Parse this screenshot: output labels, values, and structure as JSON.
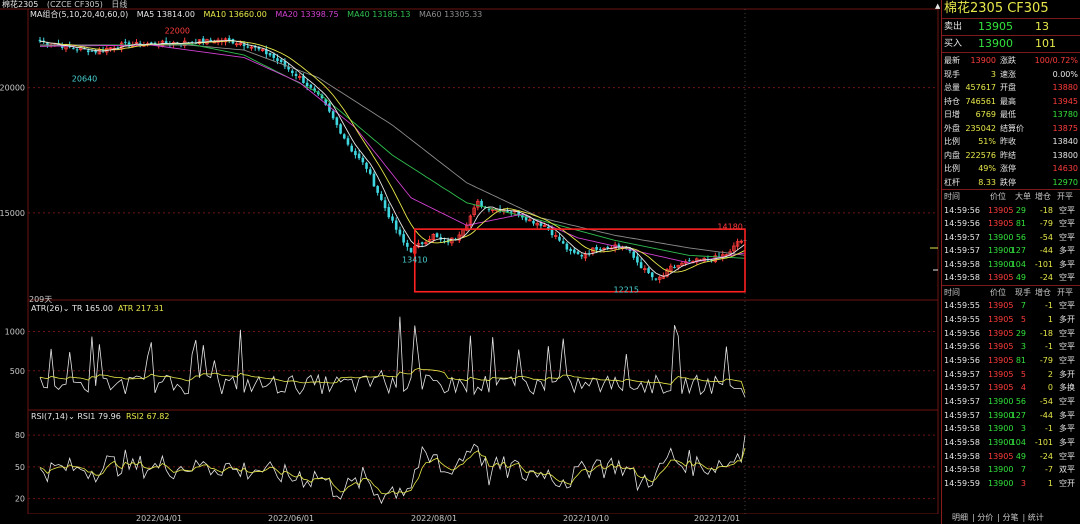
{
  "header": {
    "title": "棉花2305",
    "exchange": "(CZCE CF305)",
    "period": "日线",
    "ma_group": "MA组合(5,10,20,40,60,0)",
    "ma5": "MA5 13814.00",
    "ma10": "MA10 13660.00",
    "ma20": "MA20 13398.75",
    "ma40": "MA40 13185.13",
    "ma60": "MA60 13305.33"
  },
  "colors": {
    "up": "#ff3c3c",
    "down": "#3fd7df",
    "ma5": "#e6e6e6",
    "ma10": "#e8e84a",
    "ma20": "#d040d0",
    "ma40": "#2fbf4f",
    "ma60": "#8c8c8c",
    "grid": "#6e1414",
    "box": "#ff2020"
  },
  "chart_data": [
    {
      "type": "candlestick",
      "title": "棉花2305 日线",
      "y_ticks": [
        "20000",
        "15000"
      ],
      "y_tick_values": [
        20000,
        15000
      ],
      "ylim": [
        11600,
        22700
      ],
      "annotations": [
        {
          "label": "22000",
          "value": 22000
        },
        {
          "label": "20640",
          "value": 20640
        },
        {
          "label": "13410",
          "value": 13410
        },
        {
          "label": "12215",
          "value": 12215
        },
        {
          "label": "14180",
          "value": 14180
        }
      ],
      "price_path": [
        [
          0,
          21850
        ],
        [
          8,
          21600
        ],
        [
          15,
          21450
        ],
        [
          22,
          21700
        ],
        [
          30,
          21750
        ],
        [
          38,
          21800
        ],
        [
          45,
          21850
        ],
        [
          50,
          21900
        ],
        [
          56,
          21700
        ],
        [
          62,
          21300
        ],
        [
          66,
          20850
        ],
        [
          70,
          20400
        ],
        [
          76,
          19500
        ],
        [
          80,
          18500
        ],
        [
          84,
          17500
        ],
        [
          88,
          16800
        ],
        [
          92,
          15500
        ],
        [
          95,
          14600
        ],
        [
          98,
          13800
        ],
        [
          100,
          13500
        ],
        [
          103,
          13800
        ],
        [
          106,
          14100
        ],
        [
          109,
          13800
        ],
        [
          112,
          14000
        ],
        [
          115,
          14600
        ],
        [
          118,
          15400
        ],
        [
          120,
          15200
        ],
        [
          124,
          15150
        ],
        [
          128,
          15050
        ],
        [
          132,
          14700
        ],
        [
          136,
          14500
        ],
        [
          138,
          14200
        ],
        [
          140,
          13900
        ],
        [
          143,
          13400
        ],
        [
          146,
          13300
        ],
        [
          150,
          13600
        ],
        [
          155,
          13700
        ],
        [
          158,
          13600
        ],
        [
          160,
          13200
        ],
        [
          163,
          12700
        ],
        [
          166,
          12300
        ],
        [
          168,
          12500
        ],
        [
          170,
          12800
        ],
        [
          174,
          13000
        ],
        [
          178,
          13100
        ],
        [
          182,
          13200
        ],
        [
          186,
          13400
        ],
        [
          188,
          13850
        ],
        [
          190,
          13905
        ]
      ],
      "ma_values": {
        "ma60": [
          [
            0,
            21700
          ],
          [
            40,
            21700
          ],
          [
            55,
            21500
          ],
          [
            75,
            20400
          ],
          [
            95,
            18500
          ],
          [
            115,
            16200
          ],
          [
            135,
            14800
          ],
          [
            155,
            14100
          ],
          [
            175,
            13600
          ],
          [
            190,
            13305
          ]
        ],
        "ma40": [
          [
            0,
            21650
          ],
          [
            40,
            21750
          ],
          [
            55,
            21300
          ],
          [
            75,
            19800
          ],
          [
            95,
            17300
          ],
          [
            115,
            15400
          ],
          [
            135,
            14700
          ],
          [
            155,
            13900
          ],
          [
            175,
            13300
          ],
          [
            190,
            13185
          ]
        ],
        "ma20": [
          [
            0,
            21650
          ],
          [
            30,
            21700
          ],
          [
            55,
            21200
          ],
          [
            70,
            20200
          ],
          [
            85,
            18400
          ],
          [
            100,
            15600
          ],
          [
            115,
            14500
          ],
          [
            130,
            14950
          ],
          [
            145,
            14000
          ],
          [
            160,
            13500
          ],
          [
            175,
            13000
          ],
          [
            190,
            13399
          ]
        ]
      },
      "highlight_range": {
        "x_start": 101,
        "x_end": 190,
        "y_low": 11850,
        "y_high": 14350
      }
    },
    {
      "type": "line",
      "title": "ATR(26)",
      "series": [
        {
          "name": "TR",
          "value_label": "TR 165.00",
          "color": "#e6e6e6"
        },
        {
          "name": "ATR",
          "value_label": "ATR 217.31",
          "color": "#e8e84a"
        }
      ],
      "y_ticks": [
        "1000",
        "500"
      ],
      "y_tick_values": [
        1000,
        500
      ]
    },
    {
      "type": "line",
      "title": "RSI(7,14)",
      "series": [
        {
          "name": "RSI1",
          "value_label": "RSI1 79.96",
          "color": "#e6e6e6"
        },
        {
          "name": "RSI2",
          "value_label": "RSI2 67.82",
          "color": "#e8e84a"
        }
      ],
      "y_ticks": [
        "80",
        "50",
        "20"
      ],
      "y_tick_values": [
        80,
        50,
        20
      ]
    }
  ],
  "dates": [
    "2022/04/01",
    "2022/06/01",
    "2022/08/01",
    "2022/10/10",
    "2022/12/01"
  ],
  "days_label": "209天",
  "right_panel": {
    "title": "棉花2305  CF305",
    "ask_label": "卖出",
    "ask_price": "13905",
    "ask_vol": "13",
    "bid_label": "买入",
    "bid_price": "13900",
    "bid_vol": "101",
    "stats": [
      {
        "k1": "最新",
        "v1": "13900",
        "c1": "red",
        "k2": "涨跌",
        "v2": "100/0.72%",
        "c2": "red"
      },
      {
        "k1": "现手",
        "v1": "3",
        "c1": "yellow",
        "k2": "速涨",
        "v2": "0.00%",
        "c2": "white"
      },
      {
        "k1": "总量",
        "v1": "457617",
        "c1": "yellow",
        "k2": "开盘",
        "v2": "13880",
        "c2": "red"
      },
      {
        "k1": "持仓",
        "v1": "746561",
        "c1": "yellow",
        "k2": "最高",
        "v2": "13945",
        "c2": "red"
      },
      {
        "k1": "日增",
        "v1": "6769",
        "c1": "yellow",
        "k2": "最低",
        "v2": "13780",
        "c2": "green"
      },
      {
        "k1": "外盘",
        "v1": "235042",
        "c1": "yellow",
        "k2": "结算价",
        "v2": "13875",
        "c2": "red"
      },
      {
        "k1": "比例",
        "v1": "51%",
        "c1": "yellow",
        "k2": "昨收",
        "v2": "13840",
        "c2": "white"
      },
      {
        "k1": "内盘",
        "v1": "222576",
        "c1": "yellow",
        "k2": "昨结",
        "v2": "13800",
        "c2": "white"
      },
      {
        "k1": "比例",
        "v1": "49%",
        "c1": "yellow",
        "k2": "涨停",
        "v2": "14630",
        "c2": "red"
      },
      {
        "k1": "杠杆",
        "v1": "8.33",
        "c1": "yellow",
        "k2": "跌停",
        "v2": "12970",
        "c2": "green"
      }
    ],
    "tick_header1": {
      "time": "时间",
      "price": "价位",
      "vol": "大单",
      "oi": "增仓",
      "type": "开平"
    },
    "ticks1": [
      {
        "time": "14:59:56",
        "price": "13905",
        "vol": "29",
        "oi": "-18",
        "type": "空平"
      },
      {
        "time": "14:59:56",
        "price": "13905",
        "vol": "81",
        "oi": "-79",
        "type": "空平"
      },
      {
        "time": "14:59:57",
        "price": "13900",
        "vol": "56",
        "oi": "-54",
        "type": "空平"
      },
      {
        "time": "14:59:57",
        "price": "13900",
        "vol": "127",
        "oi": "-44",
        "type": "多平"
      },
      {
        "time": "14:59:58",
        "price": "13900",
        "vol": "104",
        "oi": "-101",
        "type": "多平"
      },
      {
        "time": "14:59:58",
        "price": "13905",
        "vol": "49",
        "oi": "-24",
        "type": "空平"
      }
    ],
    "tick_header2": {
      "time": "时间",
      "price": "价位",
      "vol": "现手",
      "oi": "增仓",
      "type": "开平"
    },
    "ticks2": [
      {
        "time": "14:59:55",
        "price": "13905",
        "vol": "7",
        "oi": "-1",
        "type": "空平"
      },
      {
        "time": "14:59:55",
        "price": "13905",
        "vol": "5",
        "oi": "1",
        "type": "多开"
      },
      {
        "time": "14:59:56",
        "price": "13905",
        "vol": "29",
        "oi": "-18",
        "type": "空平"
      },
      {
        "time": "14:59:56",
        "price": "13905",
        "vol": "3",
        "oi": "-1",
        "type": "空平"
      },
      {
        "time": "14:59:56",
        "price": "13905",
        "vol": "81",
        "oi": "-79",
        "type": "空平"
      },
      {
        "time": "14:59:57",
        "price": "13905",
        "vol": "5",
        "oi": "2",
        "type": "多开"
      },
      {
        "time": "14:59:57",
        "price": "13905",
        "vol": "4",
        "oi": "0",
        "type": "多换"
      },
      {
        "time": "14:59:57",
        "price": "13900",
        "vol": "56",
        "oi": "-54",
        "type": "空平"
      },
      {
        "time": "14:59:57",
        "price": "13900",
        "vol": "127",
        "oi": "-44",
        "type": "多平"
      },
      {
        "time": "14:59:58",
        "price": "13900",
        "vol": "3",
        "oi": "-1",
        "type": "多平"
      },
      {
        "time": "14:59:58",
        "price": "13900",
        "vol": "104",
        "oi": "-101",
        "type": "多平"
      },
      {
        "time": "14:59:58",
        "price": "13905",
        "vol": "49",
        "oi": "-24",
        "type": "空平"
      },
      {
        "time": "14:59:58",
        "price": "13900",
        "vol": "7",
        "oi": "-7",
        "type": "双平"
      },
      {
        "time": "14:59:59",
        "price": "13900",
        "vol": "3",
        "oi": "1",
        "type": "空开"
      }
    ],
    "tabs": [
      "明细",
      "分价",
      "分笔",
      "统计"
    ]
  }
}
